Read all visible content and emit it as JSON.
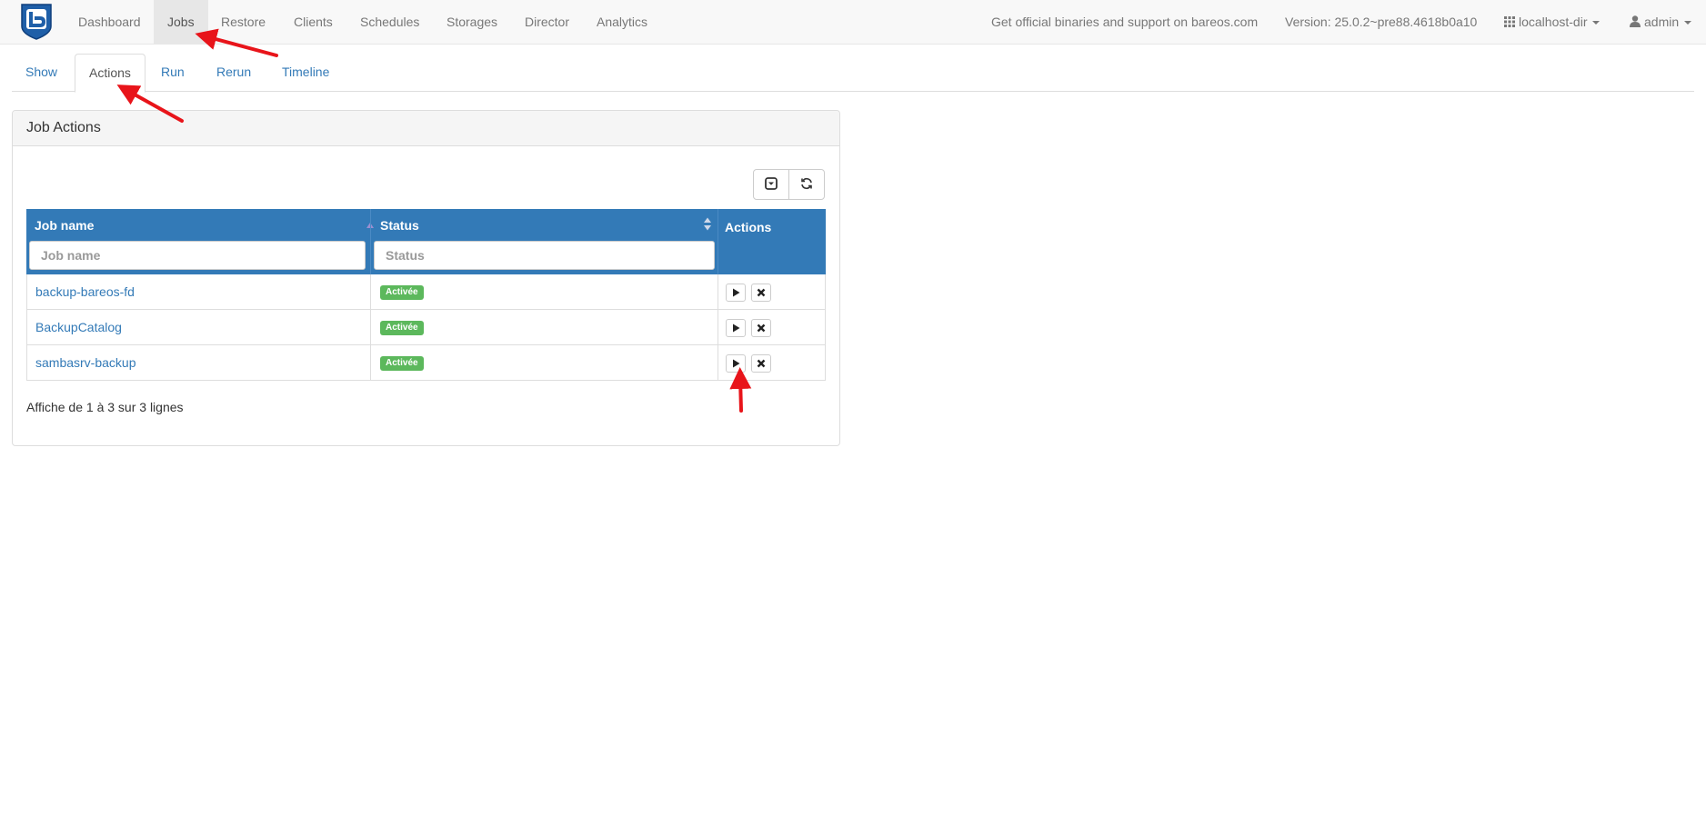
{
  "navbar": {
    "brand": "bareos-logo",
    "items": [
      {
        "label": "Dashboard",
        "active": false
      },
      {
        "label": "Jobs",
        "active": true
      },
      {
        "label": "Restore",
        "active": false
      },
      {
        "label": "Clients",
        "active": false
      },
      {
        "label": "Schedules",
        "active": false
      },
      {
        "label": "Storages",
        "active": false
      },
      {
        "label": "Director",
        "active": false
      },
      {
        "label": "Analytics",
        "active": false
      }
    ],
    "support_text": "Get official binaries and support on bareos.com",
    "version_text": "Version: 25.0.2~pre88.4618b0a10",
    "director": "localhost-dir",
    "user": "admin"
  },
  "tabs": [
    {
      "label": "Show",
      "active": false
    },
    {
      "label": "Actions",
      "active": true
    },
    {
      "label": "Run",
      "active": false
    },
    {
      "label": "Rerun",
      "active": false
    },
    {
      "label": "Timeline",
      "active": false
    }
  ],
  "panel": {
    "title": "Job Actions",
    "toolbar_icons": [
      "toggle-icon",
      "refresh-icon"
    ]
  },
  "table": {
    "columns": [
      {
        "label": "Job name",
        "filter_placeholder": "Job name"
      },
      {
        "label": "Status",
        "filter_placeholder": "Status"
      },
      {
        "label": "Actions"
      }
    ],
    "rows": [
      {
        "name": "backup-bareos-fd",
        "status": "Activée"
      },
      {
        "name": "BackupCatalog",
        "status": "Activée"
      },
      {
        "name": "sambasrv-backup",
        "status": "Activée"
      }
    ],
    "info": "Affiche de 1 à 3 sur 3 lignes"
  },
  "colors": {
    "header_bg": "#337ab7",
    "badge_success": "#5cb85c",
    "annotation_arrow": "#e8141a",
    "link": "#337ab7"
  }
}
